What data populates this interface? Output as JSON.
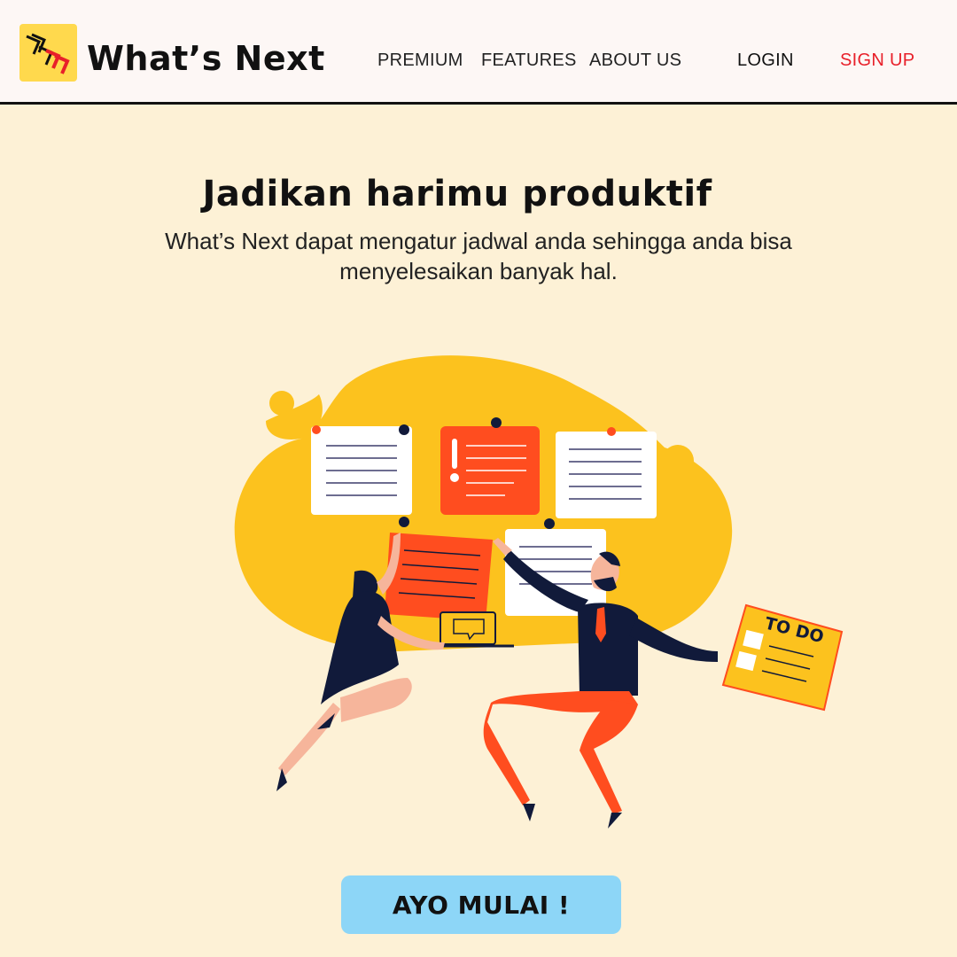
{
  "header": {
    "brand": "What’s Next",
    "nav": {
      "premium": "PREMIUM",
      "features": "FEATURES",
      "about": "ABOUT US",
      "login": "LOGIN",
      "signup": "SIGN UP"
    }
  },
  "hero": {
    "headline": "Jadikan harimu produktif",
    "subtitle": "What’s Next dapat mengatur jadwal anda sehingga anda bisa menyelesaikan banyak hal.",
    "todo_label": "TO DO",
    "cta": "AYO MULAI !"
  },
  "colors": {
    "background": "#fdf1d6",
    "header": "#fdf7f5",
    "logo_yellow": "#ffd94d",
    "accent_red": "#e8202a",
    "cta_blue": "#8dd6f7",
    "blob_yellow": "#fcc21e",
    "note_orange": "#ff4d1f"
  },
  "icons": {
    "logo": "chevron-stack-logo-icon",
    "illustration": "team-sticky-notes-illustration"
  }
}
